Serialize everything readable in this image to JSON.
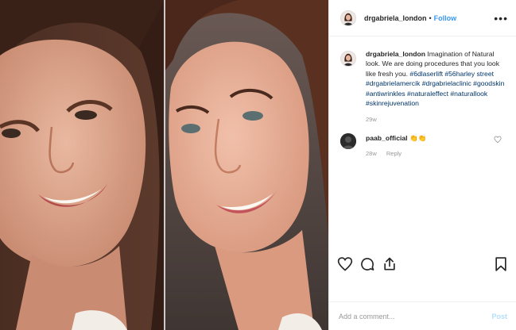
{
  "header": {
    "username": "drgabriela_london",
    "separator": "•",
    "follow_label": "Follow",
    "more_label": "•••"
  },
  "caption": {
    "username": "drgabriela_london",
    "text": "Imagination of Natural look. We are doing procedures that you look like fresh you.",
    "hashtags": "#6dlaserlift #56harley street #drgabrielamercik #drgabrielaclinic #goodskin #antiwrinkles #naturaleffect #naturallook #skinrejuvenation",
    "time": "29w"
  },
  "comment": {
    "username": "paab_official",
    "text": "👏👏",
    "time": "28w",
    "reply_label": "Reply"
  },
  "actions": {
    "icons": [
      "heart-icon",
      "comment-icon",
      "share-icon",
      "bookmark-icon"
    ]
  },
  "add_comment": {
    "placeholder": "Add a comment...",
    "post_label": "Post"
  },
  "colors": {
    "link": "#3897f0",
    "hashtag": "#003569",
    "muted": "#999999",
    "post_disabled": "#b2dffc"
  }
}
